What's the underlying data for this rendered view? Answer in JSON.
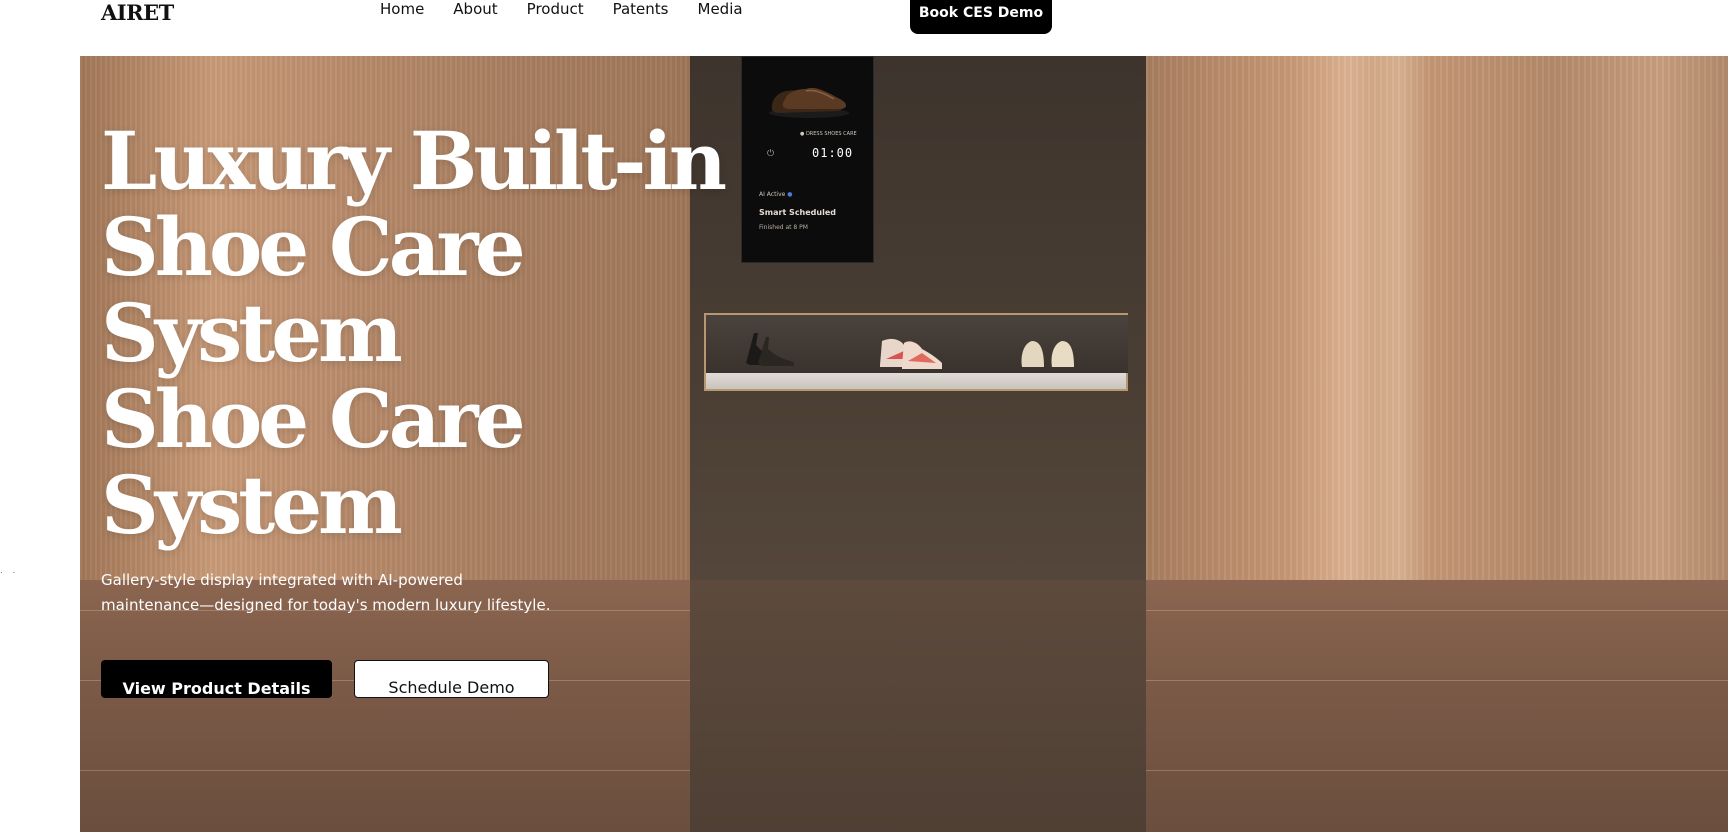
{
  "brand": {
    "logo_text": "AIRET"
  },
  "nav": {
    "items": [
      "Home",
      "About",
      "Product",
      "Patents",
      "Media"
    ],
    "cta_label": "Book CES Demo"
  },
  "hero": {
    "title_lines": [
      "Luxury Built-in",
      "Shoe Care",
      "System",
      "Shoe Care",
      "System"
    ],
    "subtitle": "Gallery-style display integrated with AI-powered maintenance—designed for today's modern luxury lifestyle.",
    "primary_button": "View Product Details",
    "secondary_button": "Schedule Demo"
  },
  "display_screen": {
    "mode_label": "● DRESS SHOES CARE",
    "timer": "01:00",
    "ai_status": "AI Active",
    "schedule_title": "Smart Scheduled",
    "schedule_detail": "Finished at 8 PM"
  },
  "colors": {
    "primary_button_bg": "#000000",
    "hero_text": "#ffffff",
    "ai_dot": "#4a7bd8"
  }
}
